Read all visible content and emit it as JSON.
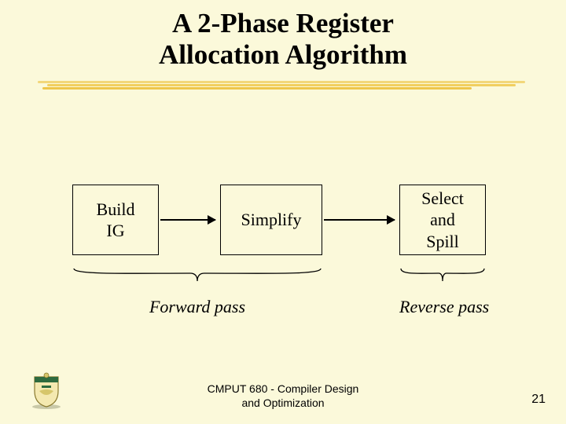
{
  "title_line1": "A 2-Phase Register",
  "title_line2": "Allocation Algorithm",
  "boxes": {
    "build": "Build\nIG",
    "simplify": "Simplify",
    "select": "Select\nand\nSpill"
  },
  "passes": {
    "forward": "Forward pass",
    "reverse": "Reverse pass"
  },
  "footer_line1": "CMPUT 680 - Compiler Design",
  "footer_line2": "and Optimization",
  "page_number": "21"
}
